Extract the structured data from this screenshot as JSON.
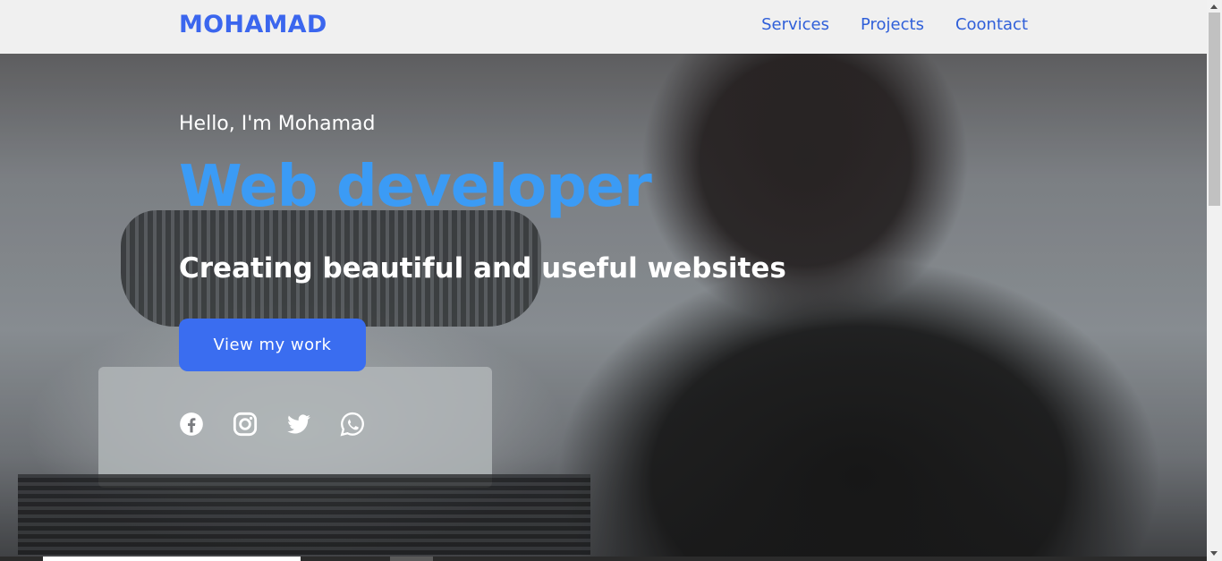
{
  "navbar": {
    "logo": "MOHAMAD",
    "links": [
      "Services",
      "Projects",
      "Coontact"
    ]
  },
  "hero": {
    "greeting": "Hello, I'm Mohamad",
    "role": "Web developer",
    "tagline": "Creating beautiful and useful websites",
    "cta_label": "View my work",
    "socials": [
      "facebook-icon",
      "instagram-icon",
      "twitter-icon",
      "whatsapp-icon"
    ]
  },
  "colors": {
    "accent": "#3a6df0",
    "role_text": "#3b9bf5",
    "logo": "#3b66ee",
    "nav_bg": "#f0f0f0"
  }
}
